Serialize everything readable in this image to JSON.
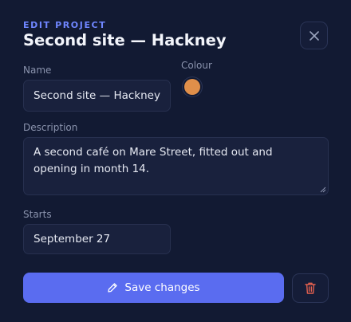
{
  "header": {
    "kicker": "EDIT PROJECT",
    "title": "Second site — Hackney"
  },
  "form": {
    "name_label": "Name",
    "name_value": "Second site — Hackney",
    "colour_label": "Colour",
    "colour_value": "#e08f4a",
    "description_label": "Description",
    "description_value": "A second café on Mare Street, fitted out and opening in month 14.",
    "starts_label": "Starts",
    "starts_value": "September 27"
  },
  "actions": {
    "save_label": "Save changes"
  },
  "colors": {
    "accent": "#5a6cf0",
    "danger": "#e2604f",
    "background": "#121a33"
  },
  "icons": {
    "close": "close-icon",
    "save": "pencil-icon",
    "delete": "trash-icon"
  }
}
